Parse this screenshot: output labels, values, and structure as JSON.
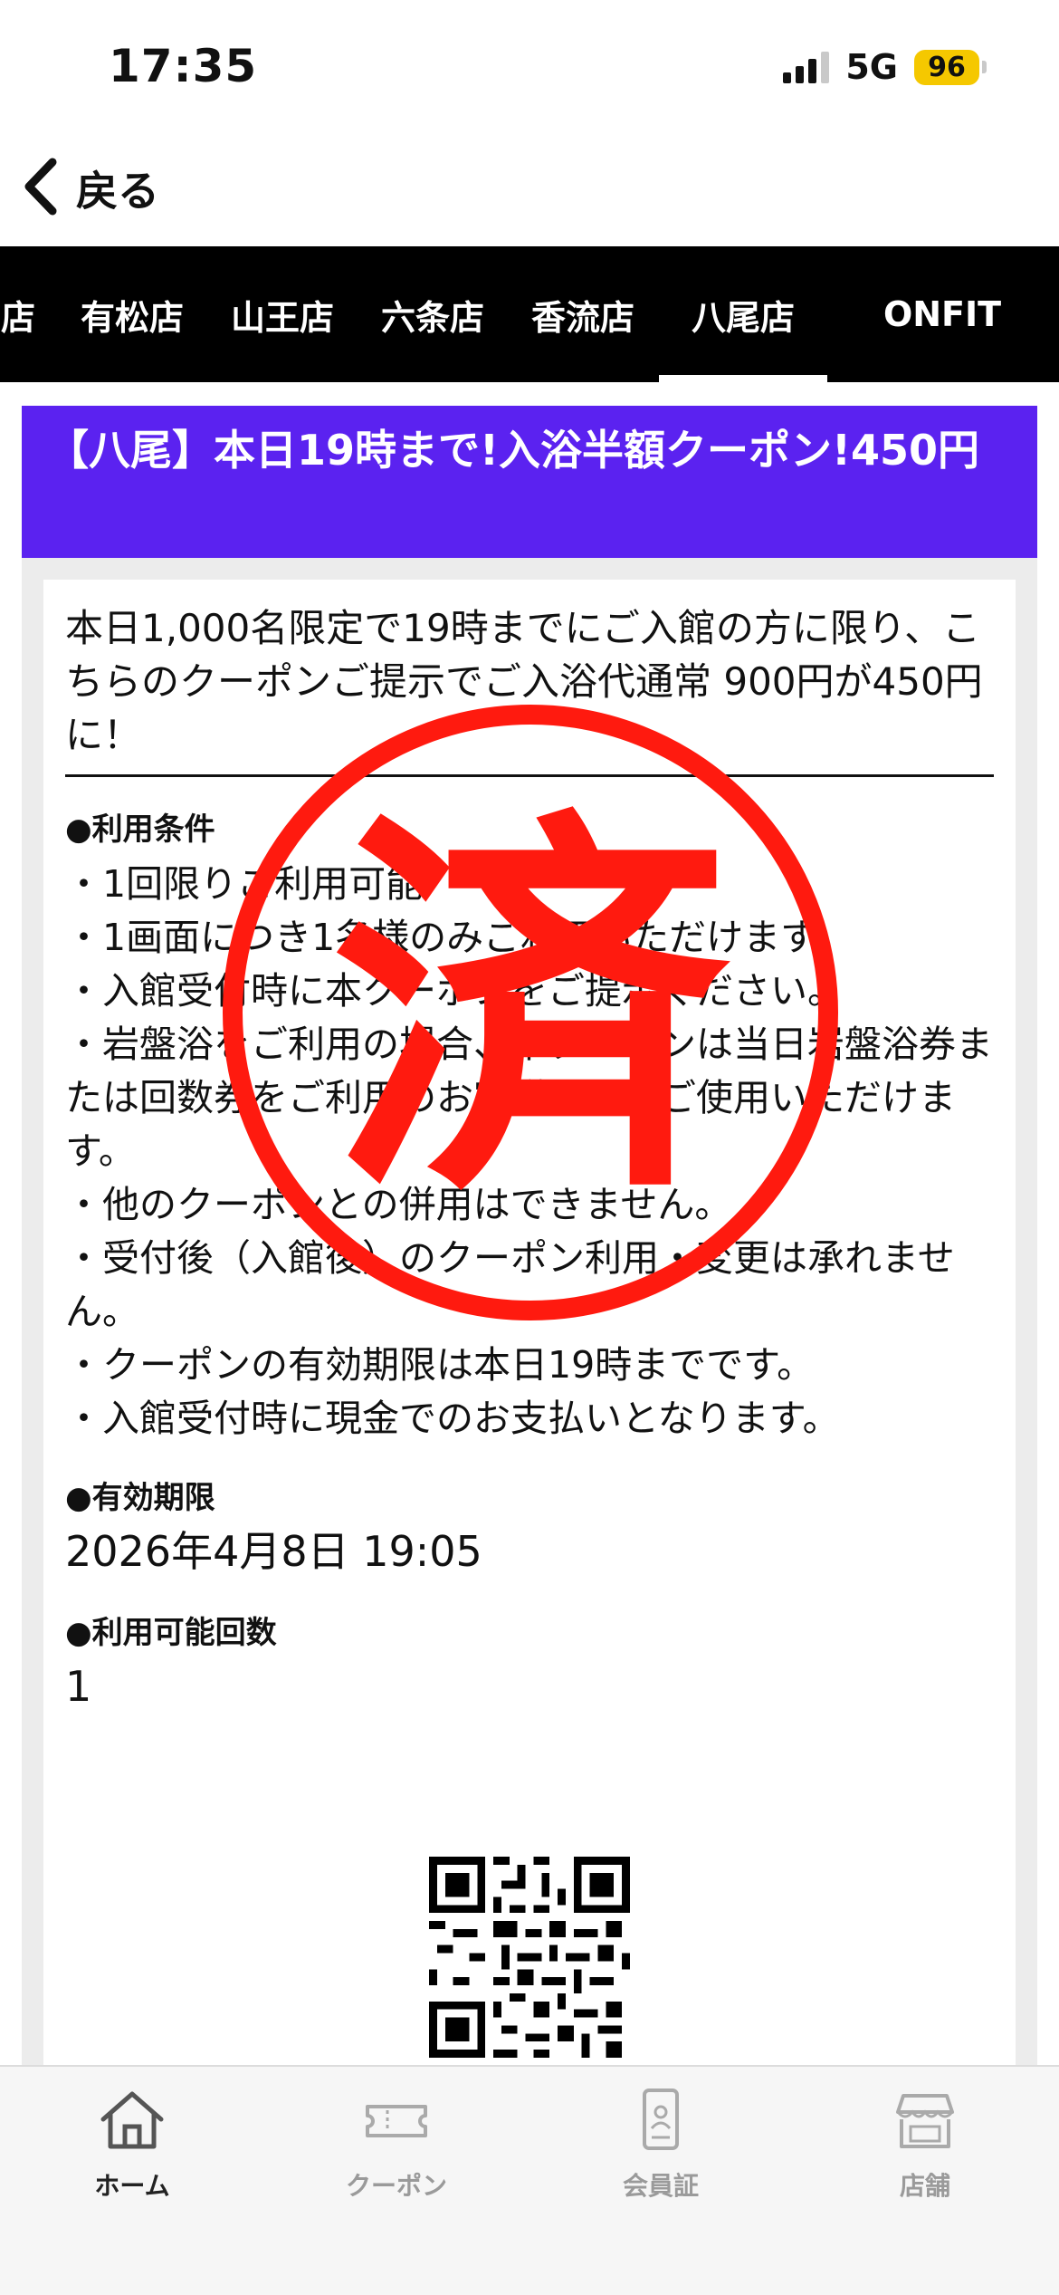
{
  "status_bar": {
    "time": "17:35",
    "network": "5G",
    "battery": "96"
  },
  "nav": {
    "back_label": "戻る"
  },
  "store_tabs": [
    {
      "label": "店",
      "active": false
    },
    {
      "label": "有松店",
      "active": false
    },
    {
      "label": "山王店",
      "active": false
    },
    {
      "label": "六条店",
      "active": false
    },
    {
      "label": "香流店",
      "active": false
    },
    {
      "label": "八尾店",
      "active": true
    },
    {
      "label": "ONFIT",
      "active": false
    }
  ],
  "coupon": {
    "title": "【八尾】本日19時まで!入浴半額クーポン!450円",
    "description": "本日1,000名限定で19時までにご入館の方に限り、こちらのクーポンご提示でご入浴代通常 900円が450円に！",
    "conditions_label": "●利用条件",
    "conditions": [
      "・1回限りご利用可能",
      "・1画面につき1名様のみご利用いただけます。",
      "・入館受付時に本クーポンをご提示ください。",
      "・岩盤浴をご利用の場合、本クーポンは当日岩盤浴券または回数券をご利用のお客様に限りご使用いただけます。",
      "・他のクーポンとの併用はできません。",
      "・受付後（入館後）のクーポン利用・変更は承れません。",
      "・クーポンの有効期限は本日19時までです。",
      "・入館受付時に現金でのお支払いとなります。"
    ],
    "expiry_label": "●有効期限",
    "expiry_value": "2026年4月8日 19:05",
    "uses_label": "●利用可能回数",
    "uses_value": "1",
    "stamp_text": "済",
    "stamp_color": "#ff1a0f",
    "header_color": "#5b22f0"
  },
  "bottom_tabs": [
    {
      "label": "ホーム",
      "icon": "home-icon",
      "active": true
    },
    {
      "label": "クーポン",
      "icon": "ticket-icon",
      "active": false
    },
    {
      "label": "会員証",
      "icon": "member-card-icon",
      "active": false
    },
    {
      "label": "店舗",
      "icon": "store-icon",
      "active": false
    }
  ]
}
